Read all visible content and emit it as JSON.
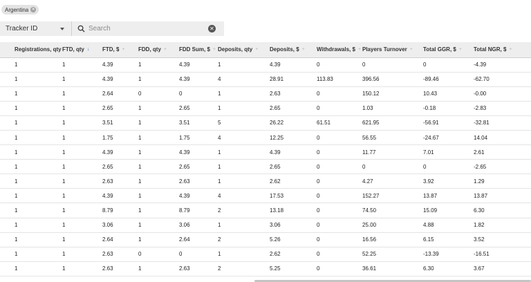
{
  "filters": {
    "chip_label": "Argentina"
  },
  "toolbar": {
    "tracker_select": "Tracker ID",
    "search_placeholder": "Search"
  },
  "table": {
    "columns": [
      {
        "label": "Registrations, qty",
        "sort": "none"
      },
      {
        "label": "FTD, qty",
        "sort": "desc"
      },
      {
        "label": "FTD, $",
        "sort": "none"
      },
      {
        "label": "FDD, qty",
        "sort": "none"
      },
      {
        "label": "FDD Sum, $",
        "sort": "none"
      },
      {
        "label": "Deposits, qty",
        "sort": "none"
      },
      {
        "label": "Deposits, $",
        "sort": "none"
      },
      {
        "label": "Withdrawals, $",
        "sort": "none"
      },
      {
        "label": "Players Turnover",
        "sort": "none"
      },
      {
        "label": "Total GGR, $",
        "sort": "none"
      },
      {
        "label": "Total NGR, $",
        "sort": "none"
      }
    ],
    "rows": [
      [
        "1",
        "1",
        "4.39",
        "1",
        "4.39",
        "1",
        "4.39",
        "0",
        "0",
        "0",
        "-4.39"
      ],
      [
        "1",
        "1",
        "4.39",
        "1",
        "4.39",
        "4",
        "28.91",
        "113.83",
        "396.56",
        "-89.46",
        "-62.70"
      ],
      [
        "1",
        "1",
        "2.64",
        "0",
        "0",
        "1",
        "2.63",
        "0",
        "150.12",
        "10.43",
        "-0.00"
      ],
      [
        "1",
        "1",
        "2.65",
        "1",
        "2.65",
        "1",
        "2.65",
        "0",
        "1.03",
        "-0.18",
        "-2.83"
      ],
      [
        "1",
        "1",
        "3.51",
        "1",
        "3.51",
        "5",
        "26.22",
        "61.51",
        "621.95",
        "-56.91",
        "-32.81"
      ],
      [
        "1",
        "1",
        "1.75",
        "1",
        "1.75",
        "4",
        "12.25",
        "0",
        "56.55",
        "-24.67",
        "14.04"
      ],
      [
        "1",
        "1",
        "4.39",
        "1",
        "4.39",
        "1",
        "4.39",
        "0",
        "11.77",
        "7.01",
        "2.61"
      ],
      [
        "1",
        "1",
        "2.65",
        "1",
        "2.65",
        "1",
        "2.65",
        "0",
        "0",
        "0",
        "-2.65"
      ],
      [
        "1",
        "1",
        "2.63",
        "1",
        "2.63",
        "1",
        "2.62",
        "0",
        "4.27",
        "3.92",
        "1.29"
      ],
      [
        "1",
        "1",
        "4.39",
        "1",
        "4.39",
        "4",
        "17.53",
        "0",
        "152.27",
        "13.87",
        "13.87"
      ],
      [
        "1",
        "1",
        "8.79",
        "1",
        "8.79",
        "2",
        "13.18",
        "0",
        "74.50",
        "15.09",
        "6.30"
      ],
      [
        "1",
        "1",
        "3.06",
        "1",
        "3.06",
        "1",
        "3.06",
        "0",
        "25.00",
        "4.88",
        "1.82"
      ],
      [
        "1",
        "1",
        "2.64",
        "1",
        "2.64",
        "2",
        "5.26",
        "0",
        "16.56",
        "6.15",
        "3.52"
      ],
      [
        "1",
        "1",
        "2.63",
        "0",
        "0",
        "1",
        "2.62",
        "0",
        "52.25",
        "-13.39",
        "-16.51"
      ],
      [
        "1",
        "1",
        "2.63",
        "1",
        "2.63",
        "2",
        "5.25",
        "0",
        "36.61",
        "6.30",
        "3.67"
      ]
    ]
  }
}
